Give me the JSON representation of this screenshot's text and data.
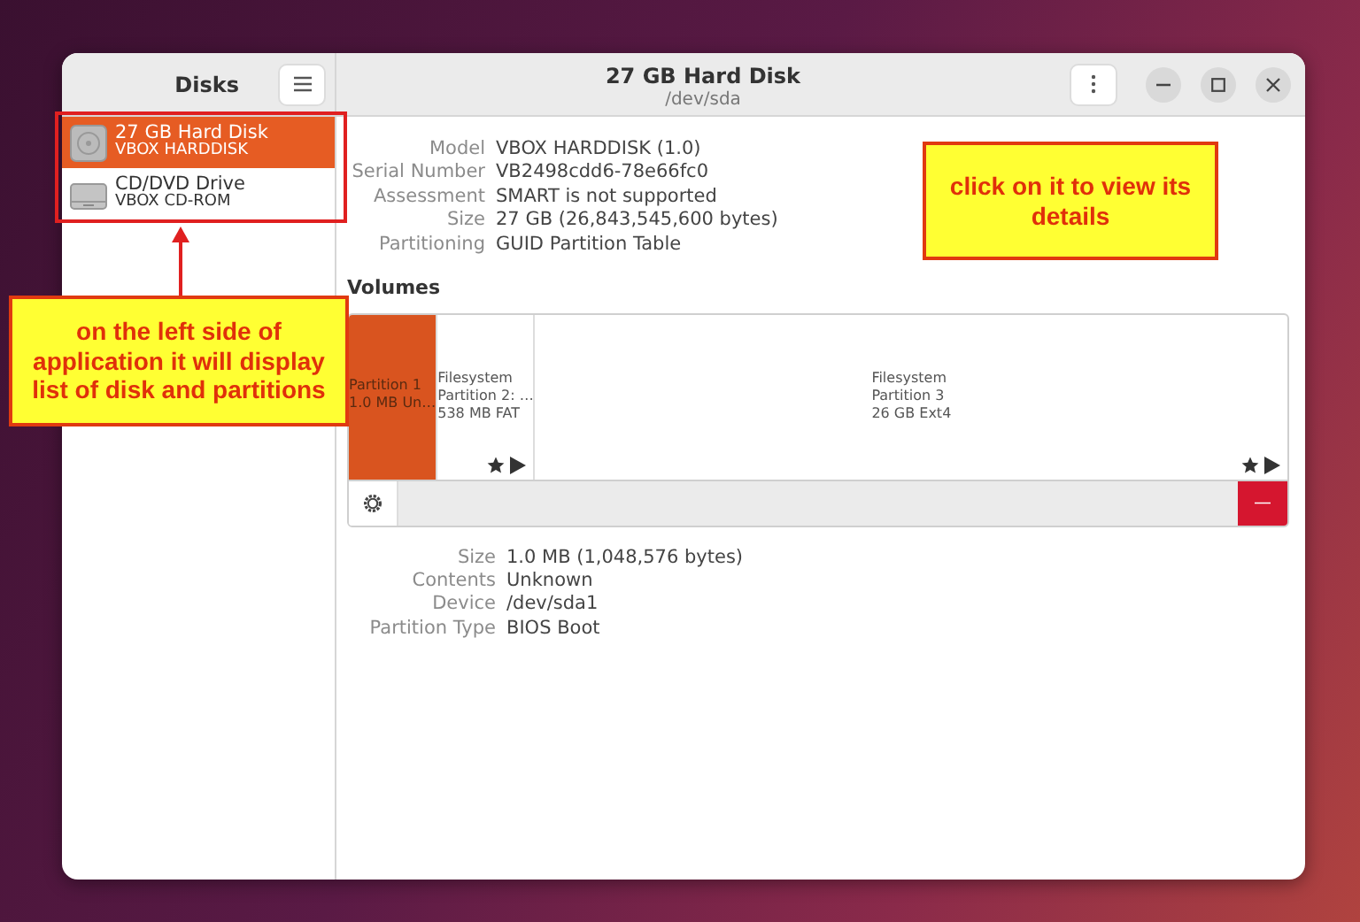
{
  "window": {
    "title": "27 GB Hard Disk",
    "subtitle": "/dev/sda"
  },
  "sidebar": {
    "title": "Disks",
    "drives": [
      {
        "name": "27 GB Hard Disk",
        "model": "VBOX HARDDISK",
        "kind": "hdd",
        "selected": true
      },
      {
        "name": "CD/DVD Drive",
        "model": "VBOX CD-ROM",
        "kind": "optical",
        "selected": false
      }
    ]
  },
  "disk_details": [
    {
      "label": "Model",
      "value": "VBOX HARDDISK (1.0)"
    },
    {
      "label": "Serial Number",
      "value": "VB2498cdd6-78e66fc0"
    },
    {
      "label": "Assessment",
      "value": "SMART is not supported"
    },
    {
      "label": "Size",
      "value": "27 GB (26,843,545,600 bytes)"
    },
    {
      "label": "Partitioning",
      "value": "GUID Partition Table"
    }
  ],
  "volumes": {
    "heading": "Volumes",
    "partitions": [
      {
        "lines": [
          "Partition 1",
          "1.0 MB Un…"
        ],
        "kind": "plain",
        "selected": true
      },
      {
        "lines": [
          "Filesystem",
          "Partition 2: …",
          "538 MB FAT"
        ],
        "kind": "filesystem",
        "selected": false
      },
      {
        "lines": [
          "Filesystem",
          "Partition 3",
          "26 GB Ext4"
        ],
        "kind": "filesystem",
        "selected": false
      }
    ],
    "delete_button": "—"
  },
  "partition_details": [
    {
      "label": "Size",
      "value": "1.0 MB (1,048,576 bytes)"
    },
    {
      "label": "Contents",
      "value": "Unknown"
    },
    {
      "label": "Device",
      "value": "/dev/sda1"
    },
    {
      "label": "Partition Type",
      "value": "BIOS Boot"
    }
  ],
  "annotations": [
    {
      "text": "on the left side of application it will display list of disk and partitions"
    },
    {
      "text": "click on it to view its details"
    }
  ]
}
